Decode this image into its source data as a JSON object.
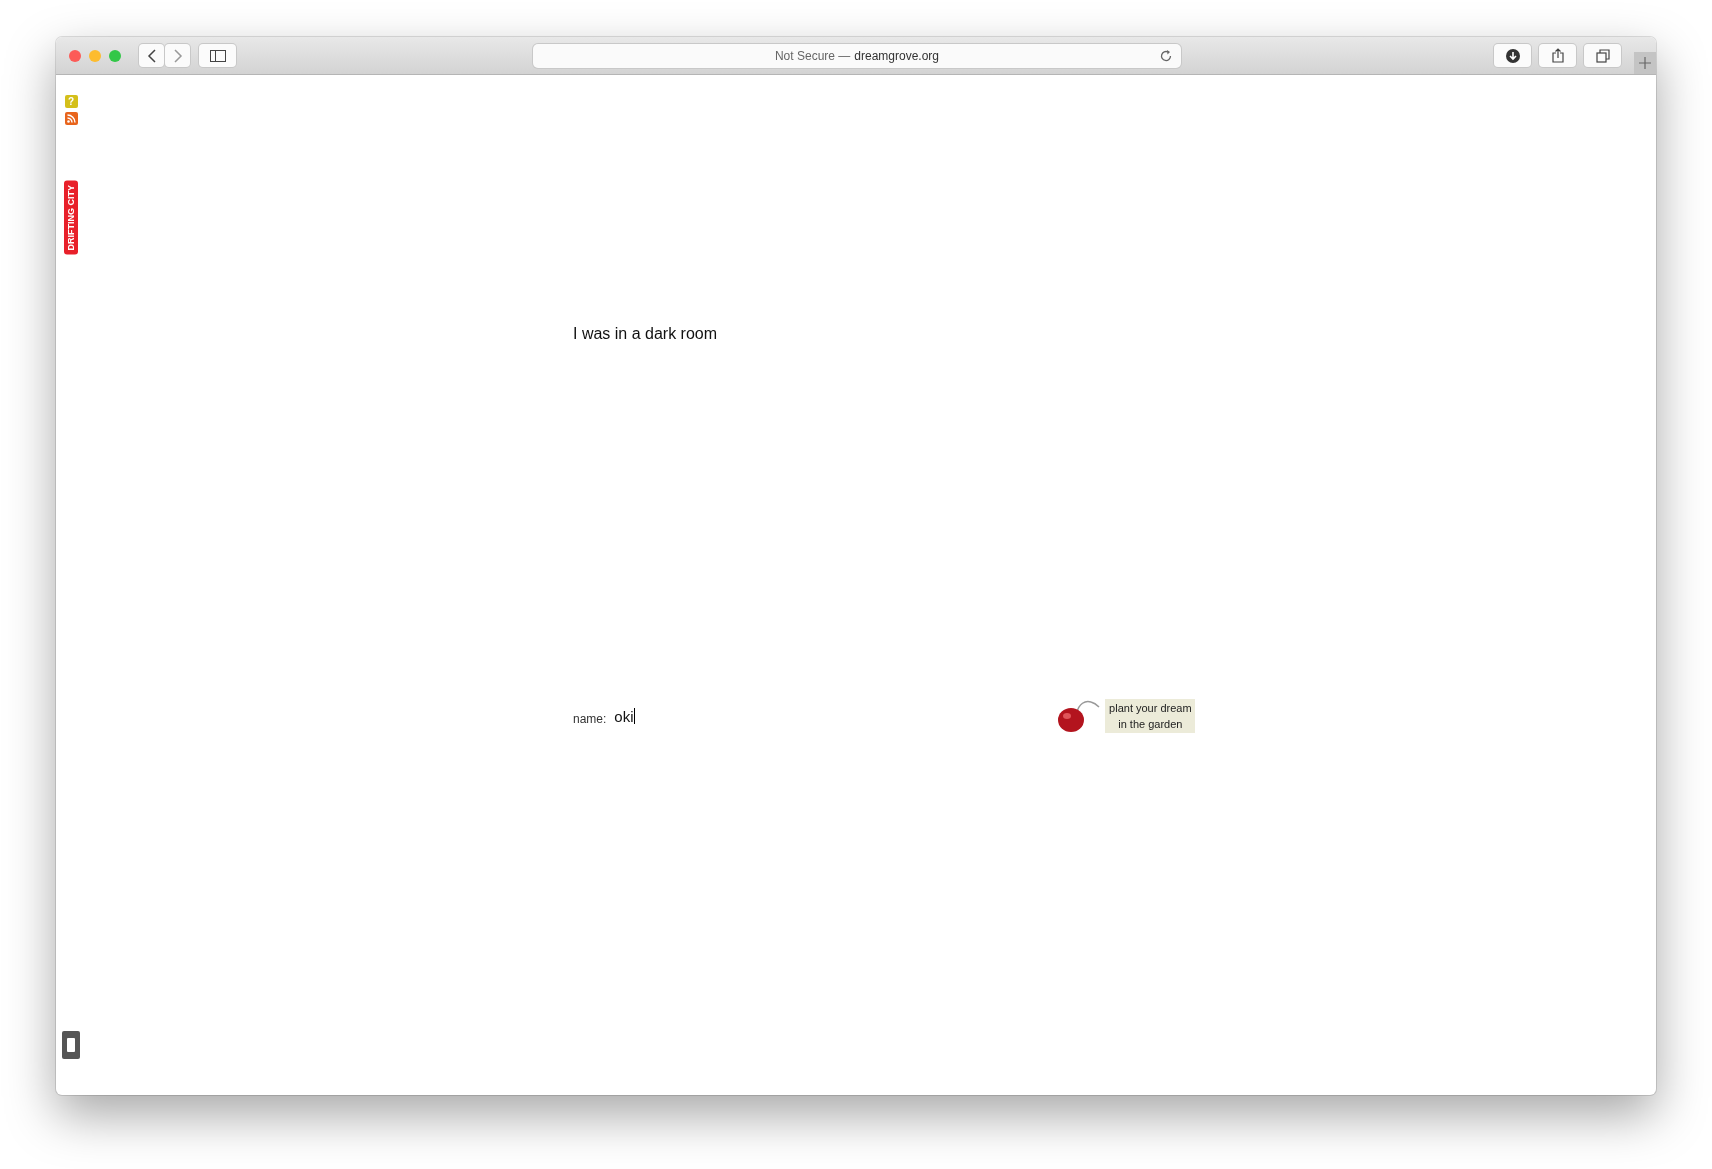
{
  "browser": {
    "security_label": "Not Secure —",
    "domain": "dreamgrove.org"
  },
  "side_badges": {
    "help": "?",
    "vertical_label": "DRIFTING CITY"
  },
  "story": {
    "text": "I was in a dark room"
  },
  "name_field": {
    "label": "name:",
    "value": "oki"
  },
  "garden_link": {
    "text": "plant your dream in the garden"
  }
}
